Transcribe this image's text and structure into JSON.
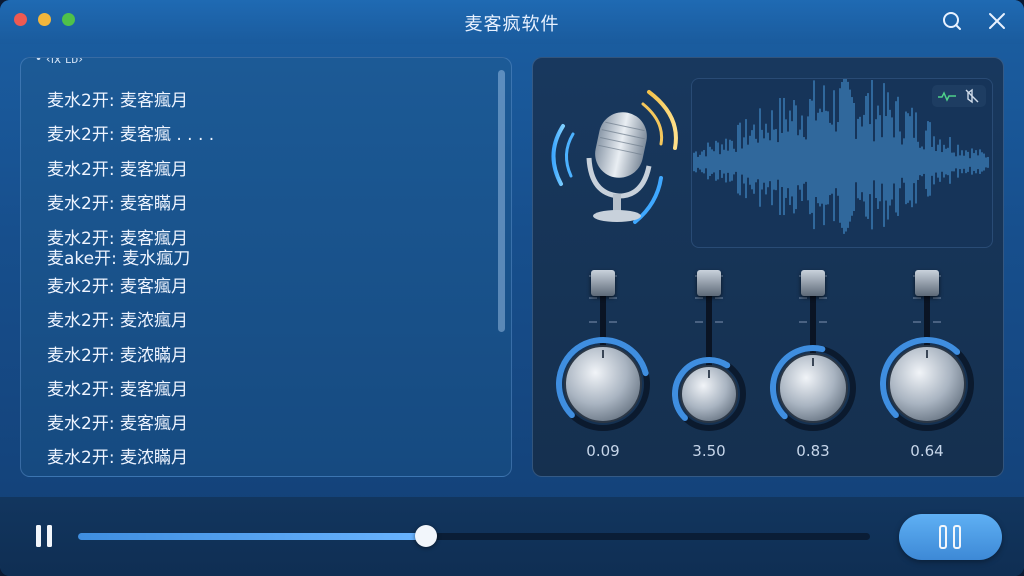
{
  "window": {
    "title": "麦客疯软件",
    "traffic_lights": {
      "close": "#ee5a52",
      "minimize": "#f2b63c",
      "maximize": "#4fc14a"
    },
    "search_icon": "search-icon",
    "close_icon": "close-icon"
  },
  "playlist": {
    "header": "• ‹ıx ʟᴅ›",
    "items": [
      {
        "label": "麦水2开: 麦客瘋月"
      },
      {
        "label": "麦水2开: 麦客瘋 . . . ."
      },
      {
        "label": "麦水2开: 麦客瘋月"
      },
      {
        "label": "麦水2开: 麦客瞞月"
      },
      {
        "label": "麦水2开: 麦客瘋月"
      },
      {
        "label": "麦ake开: 麦水瘋刀"
      },
      {
        "label": "麦水2开: 麦客瘋月"
      },
      {
        "label": "麦水2开: 麦浓瘋月"
      },
      {
        "label": "麦水2开: 麦浓瞞月"
      },
      {
        "label": "麦水2开: 麦客瘋月"
      },
      {
        "label": "麦水2开: 麦客瘋月"
      },
      {
        "label": "麦水2开: 麦浓瞞月"
      }
    ]
  },
  "mixer": {
    "mic_icon": "microphone-icon",
    "waveform_tools": [
      "waveform-icon",
      "mute-icon"
    ],
    "channels": [
      {
        "value_label": "0.09",
        "level": 0.78
      },
      {
        "value_label": "3.50",
        "level": 0.62
      },
      {
        "value_label": "0.83",
        "level": 0.55
      },
      {
        "value_label": "0.64",
        "level": 0.66
      }
    ]
  },
  "transport": {
    "pause_icon": "pause-icon",
    "progress": 0.44,
    "play_pause_button_icon": "pause-icon"
  },
  "colors": {
    "accent": "#3f8ee0",
    "accent_light": "#6ab4ff",
    "panel": "#164a80",
    "mixer_panel": "#15304f"
  }
}
